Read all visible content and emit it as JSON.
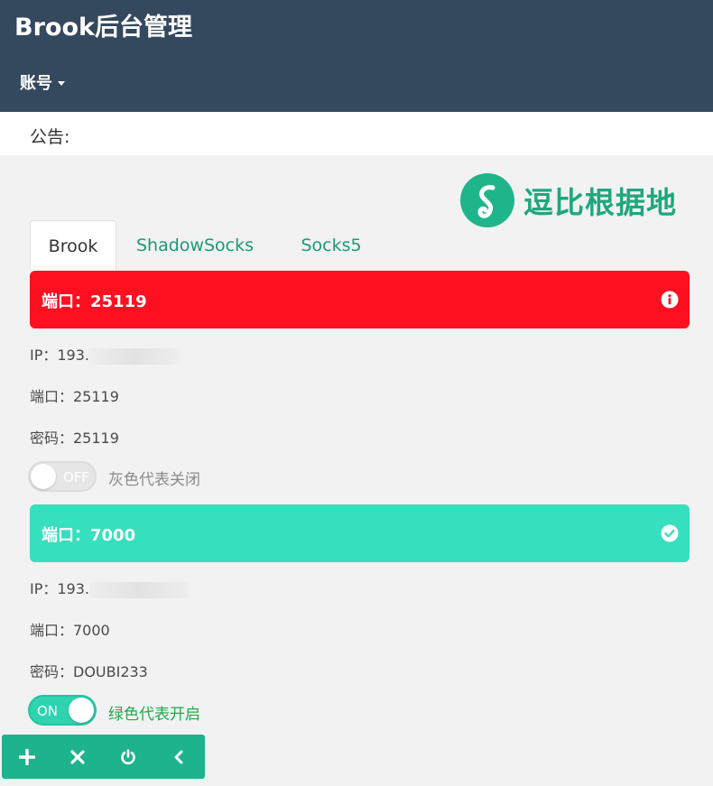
{
  "header": {
    "title": "Brook后台管理",
    "account_menu_label": "账号"
  },
  "notice": {
    "label": "公告:"
  },
  "logo": {
    "text": "逗比根据地"
  },
  "tabs": [
    {
      "label": "Brook",
      "active": true
    },
    {
      "label": "ShadowSocks",
      "active": false
    },
    {
      "label": "Socks5",
      "active": false
    }
  ],
  "entries": [
    {
      "header": "端口：25119",
      "status_icon": "info-icon",
      "status_color": "#fe1020",
      "ip": "IP：193.",
      "port": "端口：25119",
      "password": "密码：25119",
      "switch_label": "OFF",
      "switch_caption": "灰色代表关闭",
      "enabled": false
    },
    {
      "header": "端口：7000",
      "status_icon": "check-circle-icon",
      "status_color": "#36dfbd",
      "ip": "IP：193.",
      "port": "端口：7000",
      "password": "密码：DOUBI233",
      "switch_label": "ON",
      "switch_caption": "绿色代表开启",
      "enabled": true
    }
  ],
  "toolbar": {
    "buttons": [
      "plus-icon",
      "close-icon",
      "power-icon",
      "chevron-left-icon"
    ]
  },
  "colors": {
    "topbar": "#34495e",
    "accent": "#1cb38d",
    "off_caption": "#8a8a8a",
    "on_caption": "#1faa4a"
  }
}
